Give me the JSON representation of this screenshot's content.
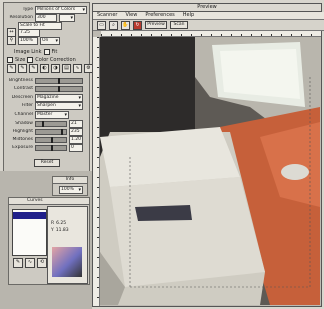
{
  "control_panel": {
    "rows": [
      {
        "label": "Type",
        "value": "Millions of Colors"
      },
      {
        "label": "Resolution",
        "value": "300"
      },
      {
        "label": "",
        "value": "Scale to Fit"
      },
      {
        "label": "",
        "value": "7.25"
      },
      {
        "label": "",
        "value": "100%"
      },
      {
        "label": "",
        "value": "On"
      }
    ],
    "checkbox_labels": [
      "Image Link",
      "Fit",
      "Size",
      "Color Correction"
    ],
    "adjustments": [
      {
        "label": "Brightness",
        "level": 0.5
      },
      {
        "label": "Contrast",
        "level": 0.5
      }
    ],
    "dropdowns": [
      {
        "label": "Descreen",
        "value": "Magazine"
      },
      {
        "label": "Filter",
        "value": "Sharpen"
      },
      {
        "label": "Channel",
        "value": "Master"
      }
    ],
    "levels": [
      {
        "label": "Shadow",
        "value": "21",
        "level": 0.2
      },
      {
        "label": "Highlight",
        "value": "235",
        "level": 0.85
      },
      {
        "label": "Midtones",
        "value": "1.20",
        "level": 0.5
      },
      {
        "label": "Exposure",
        "value": "0",
        "level": 0.5
      }
    ],
    "reset_label": "Reset"
  },
  "info_panel": {
    "title": "Info",
    "value": "100%"
  },
  "curves_panel": {
    "title": "Curves",
    "selected_item": "",
    "readouts": [
      {
        "label": "R",
        "value": "6.25"
      },
      {
        "label": "Y",
        "value": "11.83"
      }
    ]
  },
  "preview_window": {
    "title": "Preview",
    "menu": [
      "Scanner",
      "View",
      "Preferences",
      "Help"
    ],
    "toolbar": {
      "preview_label": "Preview",
      "scan_label": "Scan"
    }
  },
  "colors": {
    "panel": "#cdcac2",
    "selection": "#20208a",
    "desk_orange": "#c6603a"
  }
}
